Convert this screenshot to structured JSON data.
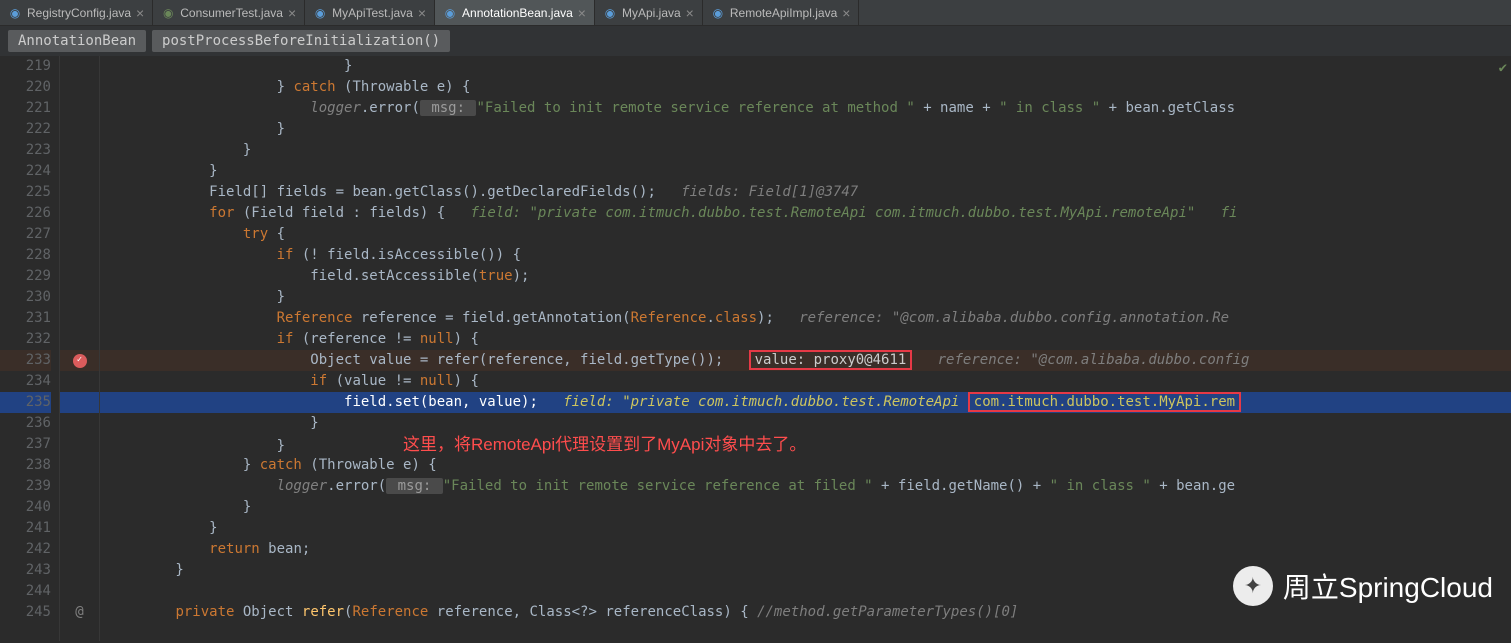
{
  "tabs": [
    {
      "label": "RegistryConfig.java",
      "active": false,
      "icon": "class"
    },
    {
      "label": "ConsumerTest.java",
      "active": false,
      "icon": "java"
    },
    {
      "label": "MyApiTest.java",
      "active": false,
      "icon": "class"
    },
    {
      "label": "AnnotationBean.java",
      "active": true,
      "icon": "class"
    },
    {
      "label": "MyApi.java",
      "active": false,
      "icon": "class"
    },
    {
      "label": "RemoteApiImpl.java",
      "active": false,
      "icon": "class"
    }
  ],
  "breadcrumb": {
    "a": "AnnotationBean",
    "b": "postProcessBeforeInitialization()"
  },
  "lines": {
    "start": 219,
    "count": 27
  },
  "code": {
    "l220_catch": "catch",
    "l220_throw": " (Throwable e) {",
    "l221_logger": "logger",
    "l221_error": ".error(",
    "l221_msg": " msg: ",
    "l221_s": "\"Failed to init remote service reference at method \"",
    "l221_p": " + name + ",
    "l221_s2": "\" in class \"",
    "l221_p2": " + bean.getClass",
    "l225_a": "Field[] fields = bean.getClass().getDeclaredFields();",
    "l225_h": "fields: Field[1]@3747",
    "l226_for": "for",
    "l226_a": " (Field field : fields) {",
    "l226_h": "field: \"private com.itmuch.dubbo.test.RemoteApi com.itmuch.dubbo.test.MyApi.remoteApi\"   fi",
    "l227_try": "try",
    "l227_b": " {",
    "l228_if": "if",
    "l228_a": " (! field.isAccessible()) {",
    "l229_a": "field.setAccessible(",
    "l229_true": "true",
    "l229_b": ");",
    "l231_ref": "Reference",
    "l231_a": " reference = field.getAnnotation(",
    "l231_cls": "Reference",
    "l231_b": ".",
    "l231_c": "class",
    "l231_d": ");",
    "l231_h": "reference: \"@com.alibaba.dubbo.config.annotation.Re",
    "l232_if": "if",
    "l232_a": " (reference != ",
    "l232_null": "null",
    "l232_b": ") {",
    "l233_a": "Object value = refer(reference, field.getType());",
    "l233_box": "value: proxy0@4611",
    "l233_h": "reference: \"@com.alibaba.dubbo.config",
    "l234_if": "if",
    "l234_a": " (value != ",
    "l234_null": "null",
    "l234_b": ") {",
    "l235_a": "field.set(bean, value);",
    "l235_h": "field: \"private com.itmuch.dubbo.test.RemoteApi",
    "l235_box": "com.itmuch.dubbo.test.MyApi.rem",
    "l237_b": "}",
    "l238_catch": "catch",
    "l238_a": " (Throwable e) {",
    "l239_logger": "logger",
    "l239_err": ".error(",
    "l239_msg": " msg: ",
    "l239_s": "\"Failed to init remote service reference at filed \"",
    "l239_p": " + field.getName() + ",
    "l239_s2": "\" in class \"",
    "l239_p2": " + bean.ge",
    "l242_ret": "return",
    "l242_a": " bean;",
    "l245_priv": "private",
    "l245_a": " Object ",
    "l245_ref": "refer",
    "l245_b": "(",
    "l245_cls": "Reference",
    "l245_c": " reference, Class<?> referenceClass) {",
    "l245_h": " //method.getParameterTypes()[0]"
  },
  "callout": "这里，将RemoteApi代理设置到了MyApi对象中去了。",
  "watermark": "周立SpringCloud"
}
